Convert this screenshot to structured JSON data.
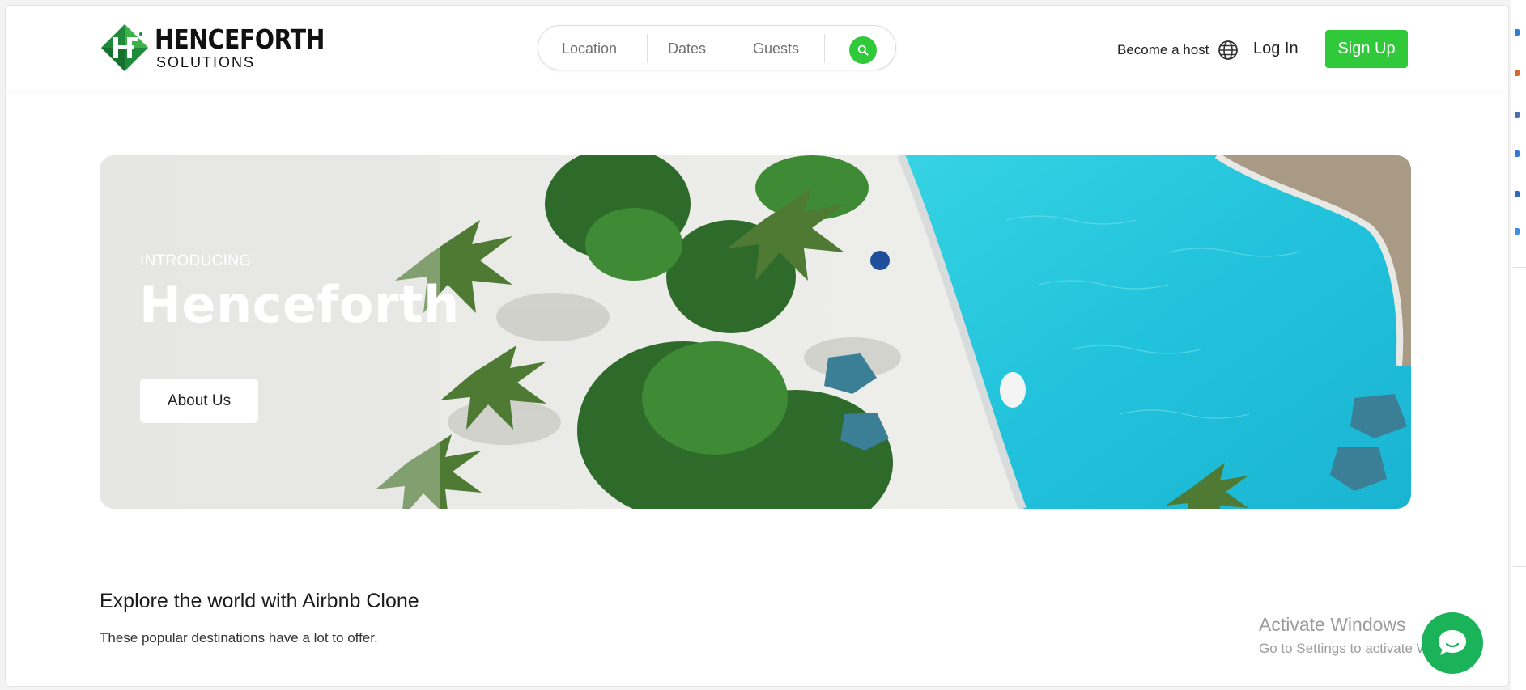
{
  "header": {
    "brand_name": "HENCEFORTH",
    "brand_sub": "SOLUTIONS",
    "search": {
      "location_label": "Location",
      "dates_label": "Dates",
      "guests_label": "Guests",
      "button_icon": "search-icon"
    },
    "become_host": "Become a host",
    "language_icon": "globe-icon",
    "login": "Log In",
    "signup": "Sign Up"
  },
  "hero": {
    "intro": "INTRODUCING",
    "title": "Henceforth",
    "cta": "About Us"
  },
  "explore": {
    "title": "Explore the world with Airbnb Clone",
    "subtitle": "These popular destinations have a lot to offer."
  },
  "overlay": {
    "windows_title": "Activate Windows",
    "windows_sub": "Go to Settings to activate Windows.",
    "chat_icon": "chat-bubble-icon"
  },
  "colors": {
    "accent": "#2fc93a",
    "chat": "#1bb35a",
    "logo_green": "#1f8a3a"
  }
}
